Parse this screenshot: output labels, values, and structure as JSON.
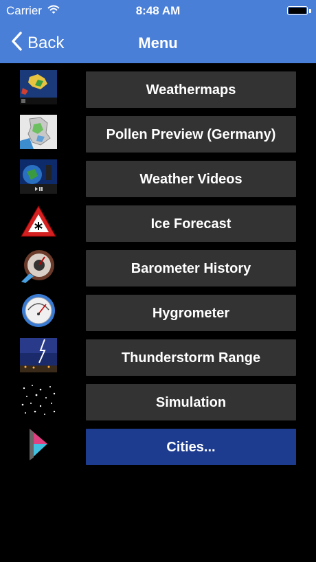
{
  "status": {
    "carrier": "Carrier",
    "time": "8:48 AM"
  },
  "nav": {
    "back_label": "Back",
    "title": "Menu"
  },
  "menu": {
    "items": [
      {
        "label": "Weathermaps",
        "icon": "weather-map-thumbnail"
      },
      {
        "label": "Pollen Preview (Germany)",
        "icon": "pollen-map-thumbnail"
      },
      {
        "label": "Weather Videos",
        "icon": "weather-video-thumbnail"
      },
      {
        "label": "Ice Forecast",
        "icon": "ice-warning-icon"
      },
      {
        "label": "Barometer History",
        "icon": "barometer-icon"
      },
      {
        "label": "Hygrometer",
        "icon": "hygrometer-icon"
      },
      {
        "label": "Thunderstorm Range",
        "icon": "lightning-thumbnail"
      },
      {
        "label": "Simulation",
        "icon": "simulation-thumbnail"
      },
      {
        "label": "Cities...",
        "icon": "cities-icon"
      }
    ]
  },
  "colors": {
    "bar": "#4a7fd7",
    "button": "#333333",
    "primary_button": "#1e3c8f"
  }
}
